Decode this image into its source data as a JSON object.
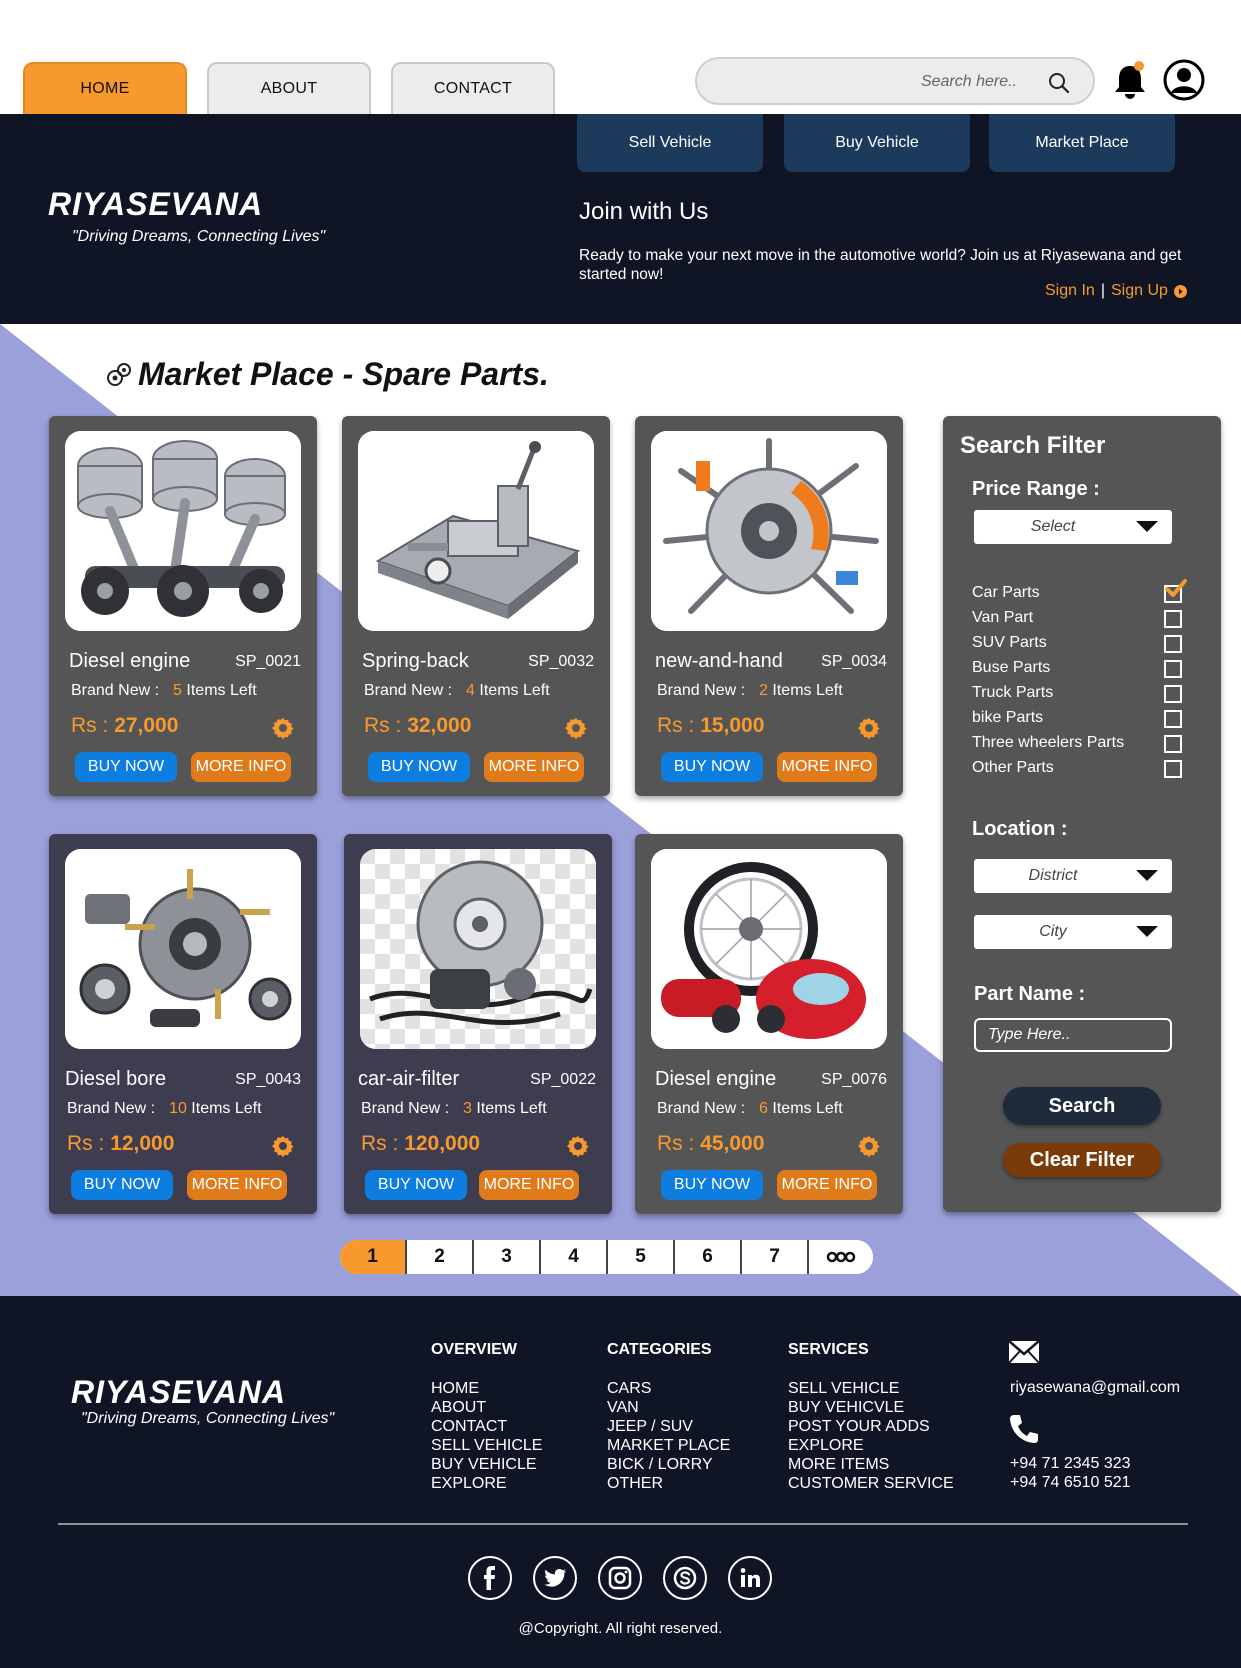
{
  "nav": {
    "tabs": [
      {
        "label": "HOME",
        "active": true
      },
      {
        "label": "ABOUT",
        "active": false
      },
      {
        "label": "CONTACT",
        "active": false
      }
    ],
    "search_placeholder": "Search here.."
  },
  "hero": {
    "brand": "RIYASEVANA",
    "tagline": "\"Driving Dreams, Connecting Lives\"",
    "subtabs": [
      "Sell Vehicle",
      "Buy Vehicle",
      "Market Place"
    ],
    "join_title": "Join with Us",
    "join_text": "Ready to make your next move in the automotive world? Join us at Riyasewana and get started now!",
    "sign_in": "Sign In",
    "separator": "|",
    "sign_up": "Sign Up"
  },
  "marketplace": {
    "title": "Market Place - Spare Parts.",
    "condition_label": "Brand New :",
    "items_left_label": "Items Left",
    "price_prefix": "Rs :",
    "buy_label": "BUY NOW",
    "more_label": "MORE INFO",
    "products": [
      {
        "name": "Diesel engine",
        "code": "SP_0021",
        "count": "5",
        "price": "27,000",
        "image": "engine-pistons"
      },
      {
        "name": "Spring-back",
        "code": "SP_0032",
        "count": "4",
        "price": "32,000",
        "image": "spring-back-tester"
      },
      {
        "name": "new-and-hand",
        "code": "SP_0034",
        "count": "2",
        "price": "15,000",
        "image": "brake-disc-parts"
      },
      {
        "name": "Diesel bore",
        "code": "SP_0043",
        "count": "10",
        "price": "12,000",
        "image": "wheel-hub-bearings"
      },
      {
        "name": "car-air-filter",
        "code": "SP_0022",
        "count": "3",
        "price": "120,000",
        "image": "brake-disc-cables"
      },
      {
        "name": "Diesel engine",
        "code": "SP_0076",
        "count": "6",
        "price": "45,000",
        "image": "motorbike-parts"
      }
    ]
  },
  "pagination": {
    "pages": [
      "1",
      "2",
      "3",
      "4",
      "5",
      "6",
      "7"
    ],
    "active": "1",
    "more": "more-dots-icon"
  },
  "filter": {
    "title": "Search Filter",
    "price_label": "Price Range :",
    "price_select": "Select",
    "categories": [
      {
        "label": "Car Parts",
        "checked": true
      },
      {
        "label": "Van Part",
        "checked": false
      },
      {
        "label": "SUV Parts",
        "checked": false
      },
      {
        "label": "Buse Parts",
        "checked": false
      },
      {
        "label": "Truck Parts",
        "checked": false
      },
      {
        "label": "bike Parts",
        "checked": false
      },
      {
        "label": "Three wheelers Parts",
        "checked": false
      },
      {
        "label": "Other Parts",
        "checked": false
      }
    ],
    "location_label": "Location :",
    "district_select": "District",
    "city_select": "City",
    "part_name_label": "Part Name :",
    "part_name_placeholder": "Type Here..",
    "search_button": "Search",
    "clear_button": "Clear Filter"
  },
  "footer": {
    "brand": "RIYASEVANA",
    "tagline": "\"Driving Dreams, Connecting Lives\"",
    "overview": {
      "title": "OVERVIEW",
      "items": [
        "HOME",
        "ABOUT",
        "CONTACT",
        "SELL VEHICLE",
        "BUY VEHICLE",
        "EXPLORE"
      ]
    },
    "categories": {
      "title": "CATEGORIES",
      "items": [
        "CARS",
        "VAN",
        "JEEP / SUV",
        "MARKET PLACE",
        "BICK / LORRY",
        "OTHER"
      ]
    },
    "services": {
      "title": "SERVICES",
      "items": [
        "SELL VEHICLE",
        "BUY VEHICVLE",
        "POST YOUR ADDS",
        "EXPLORE",
        "MORE ITEMS",
        "CUSTOMER SERVICE"
      ]
    },
    "email": "riyasewana@gmail.com",
    "phones": [
      "+94 71 2345 323",
      "+94 74 6510 521"
    ],
    "social": [
      "facebook-icon",
      "twitter-icon",
      "instagram-icon",
      "skype-icon",
      "linkedin-icon"
    ],
    "copyright": "@Copyright. All right reserved."
  },
  "colors": {
    "accent": "#f7992f",
    "navy": "#0f1524",
    "button_blue": "#0d7ddf",
    "button_orange": "#e07b1b",
    "card_gray": "#555555",
    "diagonal_purple": "#9b9fda"
  }
}
